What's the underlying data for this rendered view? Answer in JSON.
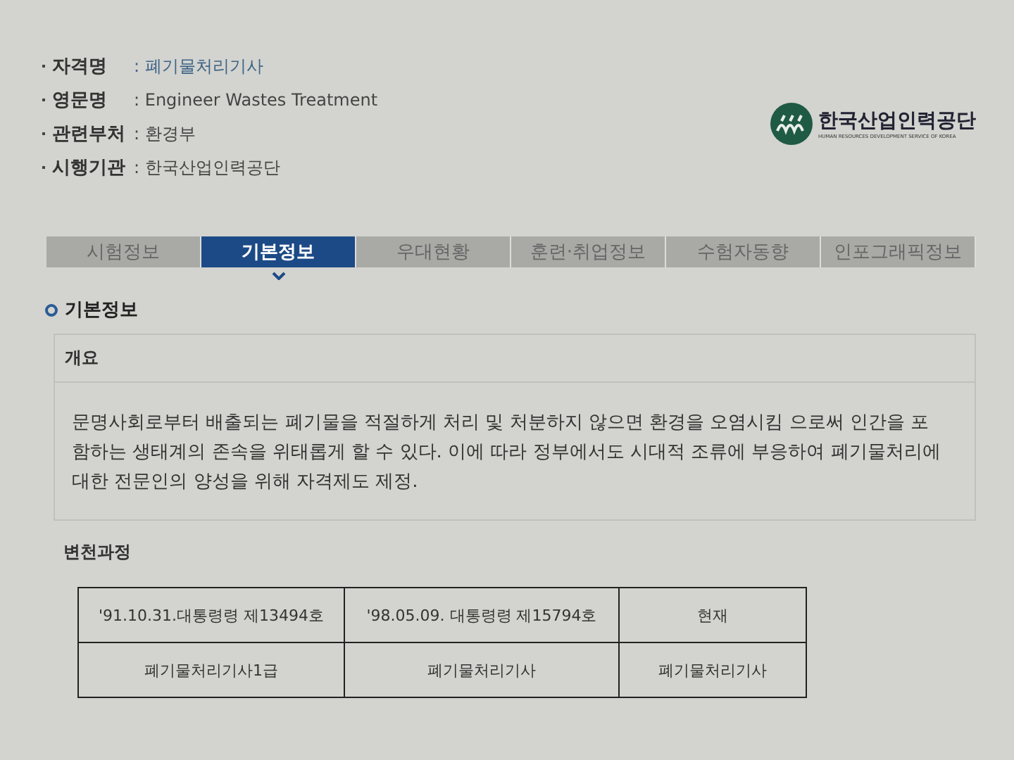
{
  "info": [
    {
      "label": "자격명",
      "value": ": 폐기물처리기사",
      "kind": "link"
    },
    {
      "label": "영문명",
      "value": ": Engineer Wastes Treatment",
      "kind": "text"
    },
    {
      "label": "관련부처",
      "value": ": 환경부",
      "kind": "text"
    },
    {
      "label": "시행기관",
      "value": ": 한국산업인력공단",
      "kind": "text"
    }
  ],
  "logo": {
    "name": "한국산업인력공단",
    "subtitle": "HUMAN RESOURCES DEVELOPMENT SERVICE OF KOREA"
  },
  "tabs": [
    {
      "label": "시험정보",
      "selected": false
    },
    {
      "label": "기본정보",
      "selected": true
    },
    {
      "label": "우대현황",
      "selected": false
    },
    {
      "label": "훈련·취업정보",
      "selected": false
    },
    {
      "label": "수험자동향",
      "selected": false
    },
    {
      "label": "인포그래픽정보",
      "selected": false
    }
  ],
  "section_title": "기본정보",
  "overview": {
    "heading": "개요",
    "text": "문명사회로부터 배출되는 폐기물을 적절하게 처리 및 처분하지 않으면 환경을 오염시킴 으로써 인간을 포함하는 생태계의 존속을 위태롭게 할 수 있다. 이에 따라 정부에서도 시대적 조류에 부응하여 폐기물처리에 대한 전문인의 양성을 위해 자격제도 제정."
  },
  "history": {
    "heading": "변천과정",
    "rows": [
      [
        "'91.10.31.대통령령 제13494호",
        "'98.05.09. 대통령령 제15794호",
        "현재"
      ],
      [
        "폐기물처리기사1급",
        "폐기물처리기사",
        "폐기물처리기사"
      ]
    ]
  }
}
